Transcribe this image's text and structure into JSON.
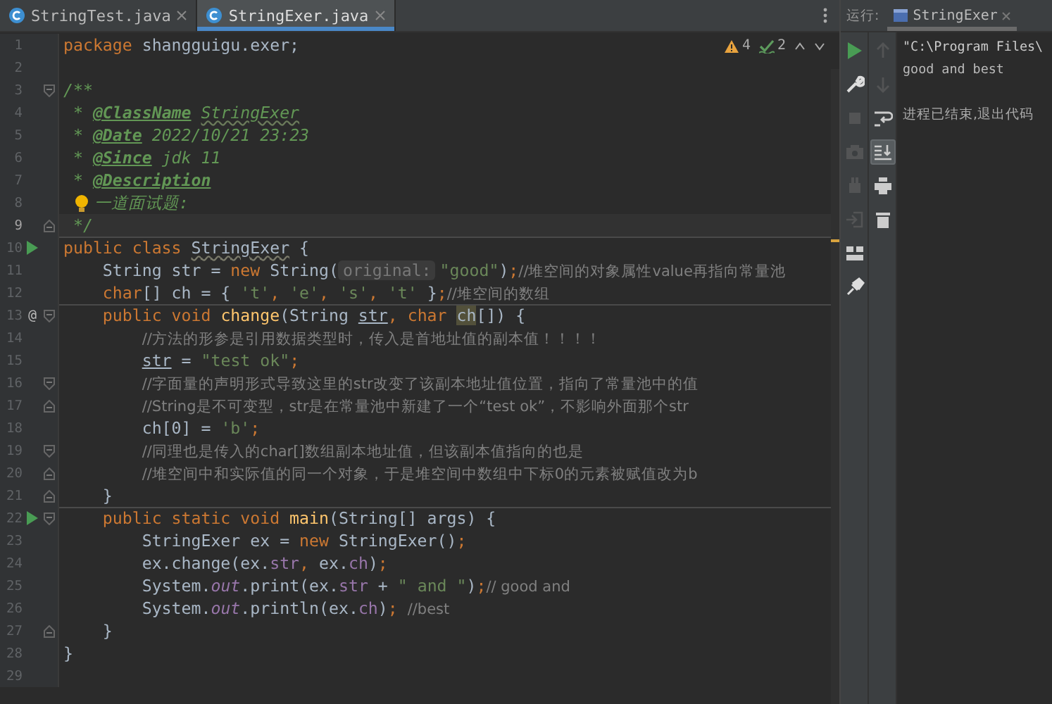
{
  "editor": {
    "tabs": [
      {
        "label": "StringTest.java",
        "selected": false
      },
      {
        "label": "StringExer.java",
        "selected": true
      }
    ],
    "inspections": [
      {
        "kind": "warning",
        "count": "4"
      },
      {
        "kind": "typo",
        "count": "2"
      }
    ],
    "lines": [
      {
        "number": "1",
        "tokens": [
          {
            "kind": "keyword",
            "text": "package "
          },
          {
            "kind": "plain",
            "text": "shangguigu.exer;"
          }
        ]
      },
      {
        "number": "2"
      },
      {
        "number": "3",
        "fold": {
          "kind": "start"
        },
        "tokens": [
          {
            "kind": "doc",
            "text": "/**"
          }
        ]
      },
      {
        "number": "4",
        "tokens": [
          {
            "kind": "doc",
            "text": " * "
          },
          {
            "kind": "doctag",
            "text": "@ClassName"
          },
          {
            "kind": "doc-warn",
            "text": "StringExer"
          }
        ]
      },
      {
        "number": "5",
        "tokens": [
          {
            "kind": "doc",
            "text": " * "
          },
          {
            "kind": "doctag",
            "text": "@Date"
          },
          {
            "kind": "doc",
            "text": " 2022/10/21 23:23"
          }
        ]
      },
      {
        "number": "6",
        "tokens": [
          {
            "kind": "doc",
            "text": " * "
          },
          {
            "kind": "doctag",
            "text": "@Since"
          },
          {
            "kind": "doc",
            "text": " jdk 11"
          }
        ]
      },
      {
        "number": "7",
        "tokens": [
          {
            "kind": "doc",
            "text": " * "
          },
          {
            "kind": "doctag",
            "text": "@Description"
          }
        ]
      },
      {
        "number": "8",
        "intention": true,
        "tokens": [
          {
            "kind": "doc",
            "text": "一道面试题:"
          }
        ]
      },
      {
        "number": "9",
        "current": true,
        "fold": {
          "kind": "end"
        },
        "tokens": [
          {
            "kind": "doc",
            "text": " */"
          }
        ]
      },
      {
        "number": "10",
        "marker": {
          "kind": "run"
        },
        "separator": true,
        "tokens": [
          {
            "kind": "keyword",
            "text": "public class "
          },
          {
            "kind": "plain-warn",
            "text": "StringExer"
          },
          {
            "kind": "plain",
            "text": " {"
          }
        ]
      },
      {
        "number": "11",
        "tokens": [
          {
            "kind": "plain",
            "text": "    String str = "
          },
          {
            "kind": "keyword",
            "text": "new "
          },
          {
            "kind": "plain",
            "text": "String("
          },
          {
            "kind": "hint",
            "text": "original:"
          },
          {
            "kind": "string",
            "text": "\"good\""
          },
          {
            "kind": "plain",
            "text": ")"
          },
          {
            "kind": "keyword",
            "text": ";"
          },
          {
            "kind": "comment",
            "text": "//堆空间的对象属性value再指向常量池"
          }
        ]
      },
      {
        "number": "12",
        "tokens": [
          {
            "kind": "keyword",
            "text": "    char"
          },
          {
            "kind": "plain",
            "text": "[] ch = { "
          },
          {
            "kind": "string",
            "text": "'t'"
          },
          {
            "kind": "keyword",
            "text": ", "
          },
          {
            "kind": "string",
            "text": "'e'"
          },
          {
            "kind": "keyword",
            "text": ", "
          },
          {
            "kind": "string",
            "text": "'s'"
          },
          {
            "kind": "keyword",
            "text": ", "
          },
          {
            "kind": "string",
            "text": "'t'"
          },
          {
            "kind": "plain",
            "text": " }"
          },
          {
            "kind": "keyword",
            "text": ";"
          },
          {
            "kind": "comment",
            "text": "//堆空间的数组"
          }
        ]
      },
      {
        "number": "13",
        "marker": {
          "kind": "override",
          "text": "@"
        },
        "fold": {
          "kind": "start"
        },
        "separator": true,
        "tokens": [
          {
            "kind": "keyword",
            "text": "    public void "
          },
          {
            "kind": "method",
            "text": "change"
          },
          {
            "kind": "plain",
            "text": "(String "
          },
          {
            "kind": "param",
            "text": "str"
          },
          {
            "kind": "keyword",
            "text": ", char "
          },
          {
            "kind": "highlight",
            "text": "ch"
          },
          {
            "kind": "plain",
            "text": "[]) {"
          }
        ]
      },
      {
        "number": "14",
        "tokens": [
          {
            "kind": "comment",
            "text": "        //方法的形参是引用数据类型时，传入是首地址值的副本值！！！！"
          }
        ]
      },
      {
        "number": "15",
        "tokens": [
          {
            "kind": "param",
            "text": "        str"
          },
          {
            "kind": "plain",
            "text": " = "
          },
          {
            "kind": "string",
            "text": "\"test ok\""
          },
          {
            "kind": "keyword",
            "text": ";"
          }
        ]
      },
      {
        "number": "16",
        "fold": {
          "kind": "start"
        },
        "tokens": [
          {
            "kind": "comment",
            "text": "        //字面量的声明形式导致这里的str改变了该副本地址值位置，指向了常量池中的值"
          }
        ]
      },
      {
        "number": "17",
        "fold": {
          "kind": "end"
        },
        "tokens": [
          {
            "kind": "comment",
            "text": "        //String是不可变型，str是在常量池中新建了一个“test ok”，不影响外面那个str"
          }
        ]
      },
      {
        "number": "18",
        "tokens": [
          {
            "kind": "plain",
            "text": "        ch[0] = "
          },
          {
            "kind": "string",
            "text": "'b'"
          },
          {
            "kind": "keyword",
            "text": ";"
          }
        ]
      },
      {
        "number": "19",
        "fold": {
          "kind": "start"
        },
        "tokens": [
          {
            "kind": "comment",
            "text": "        //同理也是传入的char[]数组副本地址值，但该副本值指向的也是"
          }
        ]
      },
      {
        "number": "20",
        "fold": {
          "kind": "end"
        },
        "tokens": [
          {
            "kind": "comment",
            "text": "        //堆空间中和实际值的同一个对象，于是堆空间中数组中下标0的元素被赋值改为b"
          }
        ]
      },
      {
        "number": "21",
        "fold": {
          "kind": "end"
        },
        "tokens": [
          {
            "kind": "plain",
            "text": "    }"
          }
        ]
      },
      {
        "number": "22",
        "marker": {
          "kind": "run"
        },
        "fold": {
          "kind": "start"
        },
        "separator": true,
        "tokens": [
          {
            "kind": "keyword",
            "text": "    public static void "
          },
          {
            "kind": "method",
            "text": "main"
          },
          {
            "kind": "plain",
            "text": "(String[] args) {"
          }
        ]
      },
      {
        "number": "23",
        "tokens": [
          {
            "kind": "plain",
            "text": "        StringExer ex = "
          },
          {
            "kind": "keyword",
            "text": "new "
          },
          {
            "kind": "plain",
            "text": "StringExer()"
          },
          {
            "kind": "keyword",
            "text": ";"
          }
        ]
      },
      {
        "number": "24",
        "tokens": [
          {
            "kind": "plain",
            "text": "        ex.change(ex."
          },
          {
            "kind": "field",
            "text": "str"
          },
          {
            "kind": "keyword",
            "text": ", "
          },
          {
            "kind": "plain",
            "text": "ex."
          },
          {
            "kind": "field",
            "text": "ch"
          },
          {
            "kind": "plain",
            "text": ")"
          },
          {
            "kind": "keyword",
            "text": ";"
          }
        ]
      },
      {
        "number": "25",
        "tokens": [
          {
            "kind": "plain",
            "text": "        System."
          },
          {
            "kind": "static",
            "text": "out"
          },
          {
            "kind": "plain",
            "text": ".print(ex."
          },
          {
            "kind": "field",
            "text": "str"
          },
          {
            "kind": "plain",
            "text": " + "
          },
          {
            "kind": "string",
            "text": "\" and \""
          },
          {
            "kind": "plain",
            "text": ")"
          },
          {
            "kind": "keyword",
            "text": ";"
          },
          {
            "kind": "comment",
            "text": "// good and"
          }
        ]
      },
      {
        "number": "26",
        "tokens": [
          {
            "kind": "plain",
            "text": "        System."
          },
          {
            "kind": "static",
            "text": "out"
          },
          {
            "kind": "plain",
            "text": ".println(ex."
          },
          {
            "kind": "field",
            "text": "ch"
          },
          {
            "kind": "plain",
            "text": ")"
          },
          {
            "kind": "keyword",
            "text": ";"
          },
          {
            "kind": "comment",
            "text": " //best"
          }
        ]
      },
      {
        "number": "27",
        "fold": {
          "kind": "end"
        },
        "tokens": [
          {
            "kind": "plain",
            "text": "    }"
          }
        ]
      },
      {
        "number": "28",
        "tokens": [
          {
            "kind": "plain",
            "text": "}"
          }
        ]
      },
      {
        "number": "29"
      }
    ]
  },
  "run_panel": {
    "label": "运行:",
    "tab": {
      "label": "StringExer"
    },
    "toolbar": [
      {
        "kind": "run",
        "disabled": false
      },
      {
        "kind": "wrench",
        "disabled": false
      },
      {
        "kind": "stop",
        "disabled": true
      },
      {
        "kind": "camera",
        "disabled": true
      },
      {
        "kind": "plug",
        "disabled": true
      },
      {
        "kind": "exit",
        "disabled": true
      },
      {
        "kind": "layout",
        "disabled": false
      },
      {
        "kind": "pin",
        "disabled": false
      }
    ],
    "side_toolbar": [
      {
        "kind": "up",
        "disabled": true,
        "selected": false
      },
      {
        "kind": "down",
        "disabled": true,
        "selected": false
      },
      {
        "kind": "wrap",
        "disabled": false,
        "selected": false
      },
      {
        "kind": "scroll-end",
        "disabled": false,
        "selected": true
      },
      {
        "kind": "print",
        "disabled": false,
        "selected": false
      },
      {
        "kind": "trash",
        "disabled": false,
        "selected": false
      }
    ],
    "output": [
      {
        "kind": "command",
        "text": "\"C:\\Program Files\\"
      },
      {
        "kind": "stdout",
        "text": "good and best"
      },
      {
        "kind": "system",
        "text": "进程已结束,退出代码"
      }
    ]
  }
}
